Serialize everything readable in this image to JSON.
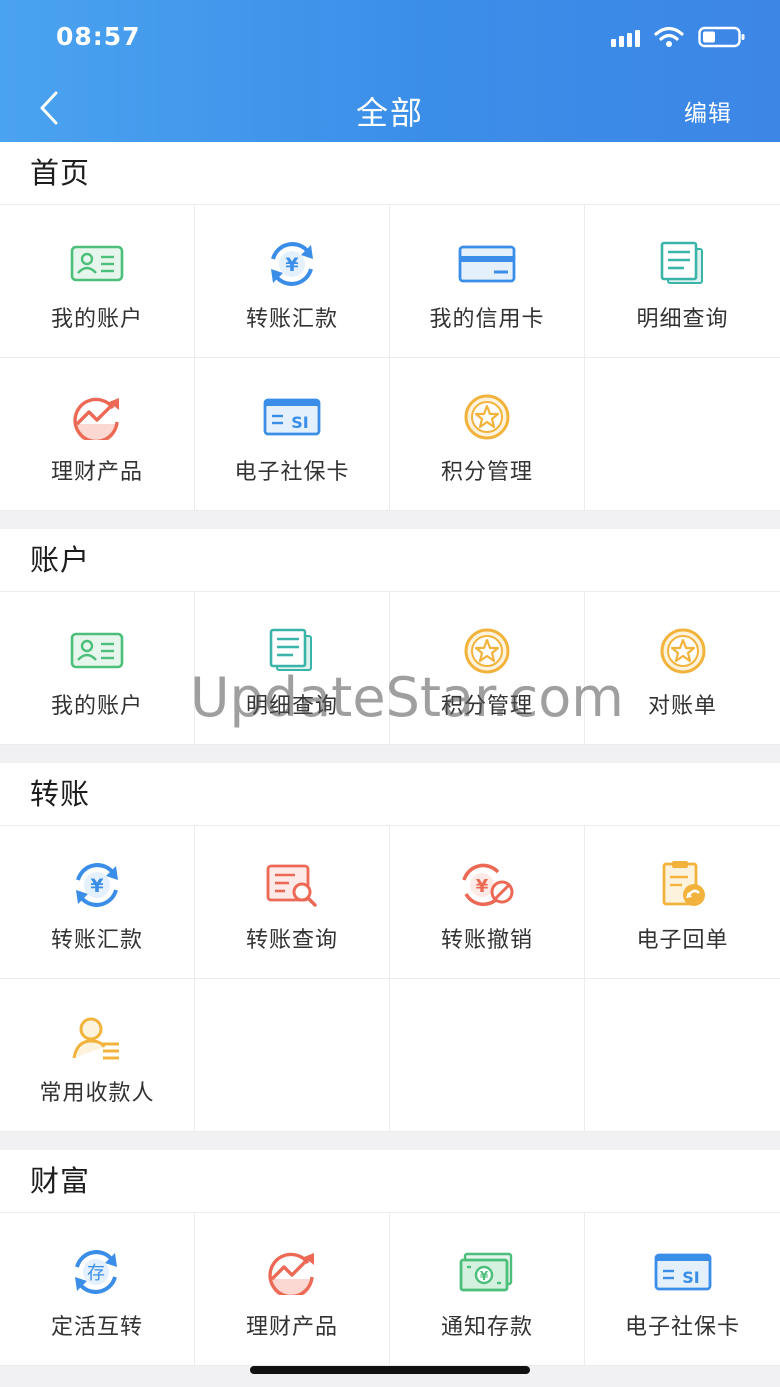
{
  "status_bar": {
    "time": "08:57"
  },
  "header": {
    "title": "全部",
    "edit_label": "编辑"
  },
  "sections": [
    {
      "title": "首页",
      "items": [
        {
          "label": "我的账户",
          "icon": "account-card-icon"
        },
        {
          "label": "转账汇款",
          "icon": "yuan-exchange-icon"
        },
        {
          "label": "我的信用卡",
          "icon": "credit-card-icon"
        },
        {
          "label": "明细查询",
          "icon": "document-list-icon"
        },
        {
          "label": "理财产品",
          "icon": "trend-chart-icon"
        },
        {
          "label": "电子社保卡",
          "icon": "social-security-card-icon"
        },
        {
          "label": "积分管理",
          "icon": "star-coin-icon"
        }
      ]
    },
    {
      "title": "账户",
      "items": [
        {
          "label": "我的账户",
          "icon": "account-card-icon"
        },
        {
          "label": "明细查询",
          "icon": "document-list-icon"
        },
        {
          "label": "积分管理",
          "icon": "star-coin-icon"
        },
        {
          "label": "对账单",
          "icon": "star-coin-icon"
        }
      ]
    },
    {
      "title": "转账",
      "items": [
        {
          "label": "转账汇款",
          "icon": "yuan-exchange-icon"
        },
        {
          "label": "转账查询",
          "icon": "transfer-search-icon"
        },
        {
          "label": "转账撤销",
          "icon": "transfer-cancel-icon"
        },
        {
          "label": "电子回单",
          "icon": "receipt-icon"
        },
        {
          "label": "常用收款人",
          "icon": "payee-icon"
        }
      ]
    },
    {
      "title": "财富",
      "items": [
        {
          "label": "定活互转",
          "icon": "deposit-convert-icon"
        },
        {
          "label": "理财产品",
          "icon": "trend-chart-icon"
        },
        {
          "label": "通知存款",
          "icon": "cash-note-icon"
        },
        {
          "label": "电子社保卡",
          "icon": "social-security-card-icon"
        }
      ]
    }
  ],
  "watermark": "UpdateStar.com",
  "colors": {
    "header_start": "#4aa3f0",
    "header_end": "#3d86e6",
    "green": "#4cbf7a",
    "blue": "#3b8ee8",
    "orange": "#f2b33d",
    "red": "#ec6a55",
    "teal": "#3ab3a8"
  }
}
